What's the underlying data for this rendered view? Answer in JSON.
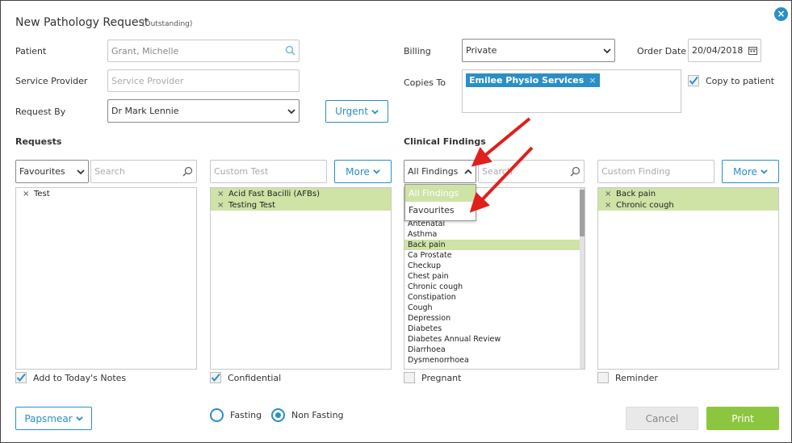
{
  "dialog": {
    "title": "New Pathology Request",
    "status": "(Outstanding)",
    "close_icon": "×"
  },
  "patient": {
    "label": "Patient",
    "value": "Grant, Michelle"
  },
  "service_provider": {
    "label": "Service Provider",
    "placeholder": "Service Provider"
  },
  "request_by": {
    "label": "Request By",
    "value": "Dr Mark Lennie"
  },
  "urgent_button": "Urgent",
  "billing": {
    "label": "Billing",
    "value": "Private"
  },
  "order_date": {
    "label": "Order Date",
    "value": "20/04/2018"
  },
  "copies_to": {
    "label": "Copies To",
    "tag": "Emilee Physio Services",
    "tag_remove": "×"
  },
  "copy_to_patient": {
    "label": "Copy to patient",
    "checked": true
  },
  "requests": {
    "heading": "Requests",
    "filter_value": "Favourites",
    "search_placeholder": "Search",
    "available": [
      {
        "name": "Test"
      }
    ],
    "custom_placeholder": "Custom Test",
    "more_label": "More",
    "selected": [
      {
        "name": "Acid Fast Bacilli (AFBs)"
      },
      {
        "name": "Testing Test"
      }
    ]
  },
  "clinical_findings": {
    "heading": "Clinical Findings",
    "filter_value": "All Findings",
    "search_placeholder": "Search",
    "filter_options": [
      {
        "label": "All Findings",
        "active": true
      },
      {
        "label": "Favourites",
        "active": false
      }
    ],
    "list": [
      {
        "name": "Antenatal",
        "selected": false
      },
      {
        "name": "Asthma",
        "selected": false
      },
      {
        "name": "Back pain",
        "selected": true
      },
      {
        "name": "Ca Prostate",
        "selected": false
      },
      {
        "name": "Checkup",
        "selected": false
      },
      {
        "name": "Chest pain",
        "selected": false
      },
      {
        "name": "Chronic cough",
        "selected": false
      },
      {
        "name": "Constipation",
        "selected": false
      },
      {
        "name": "Cough",
        "selected": false
      },
      {
        "name": "Depression",
        "selected": false
      },
      {
        "name": "Diabetes",
        "selected": false
      },
      {
        "name": "Diabetes Annual Review",
        "selected": false
      },
      {
        "name": "Diarrhoea",
        "selected": false
      },
      {
        "name": "Dysmenorrhoea",
        "selected": false
      }
    ],
    "custom_placeholder": "Custom Finding",
    "more_label": "More",
    "selected": [
      {
        "name": "Back pain"
      },
      {
        "name": "Chronic cough"
      }
    ]
  },
  "options": {
    "add_to_notes": {
      "label": "Add to Today's Notes",
      "checked": true
    },
    "confidential": {
      "label": "Confidential",
      "checked": true
    },
    "pregnant": {
      "label": "Pregnant",
      "checked": false
    },
    "reminder": {
      "label": "Reminder",
      "checked": false
    }
  },
  "papsmear_button": "Papsmear",
  "fasting": {
    "label": "Fasting",
    "selected": false
  },
  "non_fasting": {
    "label": "Non Fasting",
    "selected": true
  },
  "cancel_button": "Cancel",
  "print_button": "Print",
  "colors": {
    "accent": "#2a8fc6",
    "selected_row": "#cfe3a6",
    "print": "#8cc63f",
    "annotation_arrow": "#e0201b"
  }
}
